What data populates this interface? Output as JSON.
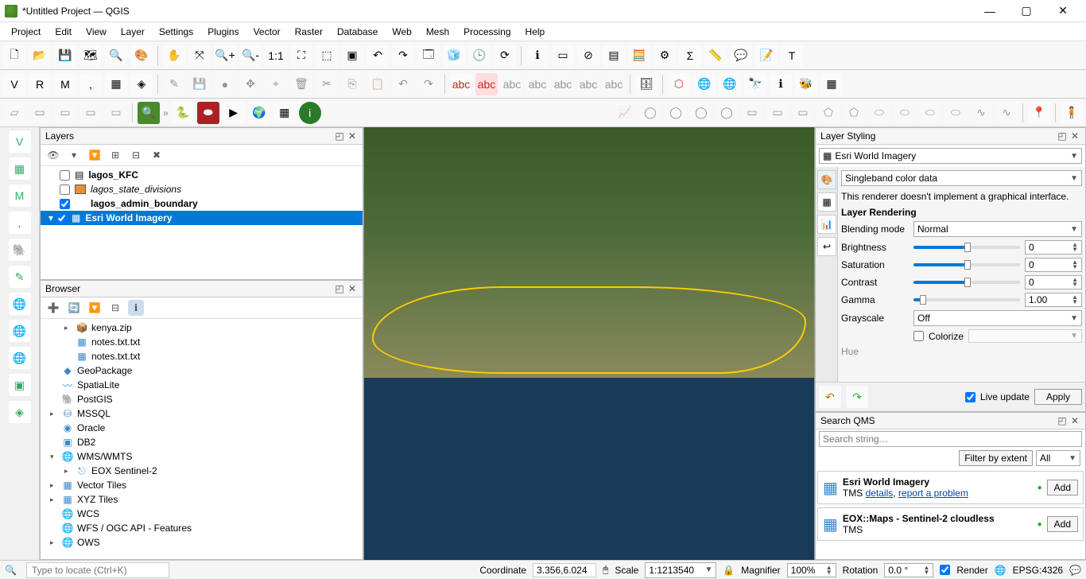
{
  "title": "*Untitled Project — QGIS",
  "menu": [
    "Project",
    "Edit",
    "View",
    "Layer",
    "Settings",
    "Plugins",
    "Vector",
    "Raster",
    "Database",
    "Web",
    "Mesh",
    "Processing",
    "Help"
  ],
  "layers_panel": {
    "title": "Layers",
    "items": [
      {
        "checked": false,
        "name": "lagos_KFC",
        "bold": true,
        "icon": "table"
      },
      {
        "checked": false,
        "name": "lagos_state_divisions",
        "italic": true,
        "swatch": "#e69138"
      },
      {
        "checked": true,
        "name": "lagos_admin_boundary",
        "bold": true
      },
      {
        "checked": true,
        "name": "Esri World Imagery",
        "bold": true,
        "selected": true,
        "raster": true
      }
    ]
  },
  "browser_panel": {
    "title": "Browser",
    "items": [
      {
        "indent": 1,
        "exp": "▸",
        "icon": "📦",
        "name": "kenya.zip"
      },
      {
        "indent": 1,
        "exp": "",
        "icon": "▦",
        "name": "notes.txt.txt"
      },
      {
        "indent": 1,
        "exp": "",
        "icon": "▦",
        "name": "notes.txt.txt"
      },
      {
        "indent": 0,
        "exp": "",
        "icon": "◆",
        "name": "GeoPackage"
      },
      {
        "indent": 0,
        "exp": "",
        "icon": "〰",
        "name": "SpatiaLite"
      },
      {
        "indent": 0,
        "exp": "",
        "icon": "🐘",
        "name": "PostGIS"
      },
      {
        "indent": 0,
        "exp": "▸",
        "icon": "⛁",
        "name": "MSSQL"
      },
      {
        "indent": 0,
        "exp": "",
        "icon": "◉",
        "name": "Oracle"
      },
      {
        "indent": 0,
        "exp": "",
        "icon": "▣",
        "name": "DB2"
      },
      {
        "indent": 0,
        "exp": "▾",
        "icon": "🌐",
        "name": "WMS/WMTS"
      },
      {
        "indent": 1,
        "exp": "▸",
        "icon": "⎋",
        "name": "EOX Sentinel-2"
      },
      {
        "indent": 0,
        "exp": "▸",
        "icon": "▦",
        "name": "Vector Tiles"
      },
      {
        "indent": 0,
        "exp": "▸",
        "icon": "▦",
        "name": "XYZ Tiles"
      },
      {
        "indent": 0,
        "exp": "",
        "icon": "🌐",
        "name": "WCS"
      },
      {
        "indent": 0,
        "exp": "",
        "icon": "🌐",
        "name": "WFS / OGC API - Features"
      },
      {
        "indent": 0,
        "exp": "▸",
        "icon": "🌐",
        "name": "OWS"
      }
    ]
  },
  "layer_styling": {
    "title": "Layer Styling",
    "layer": "Esri World Imagery",
    "renderer": "Singleband color data",
    "note": "This renderer doesn't implement a graphical interface.",
    "section": "Layer Rendering",
    "blending_label": "Blending mode",
    "blending": "Normal",
    "brightness_label": "Brightness",
    "brightness": "0",
    "saturation_label": "Saturation",
    "saturation": "0",
    "contrast_label": "Contrast",
    "contrast": "0",
    "gamma_label": "Gamma",
    "gamma": "1.00",
    "grayscale_label": "Grayscale",
    "grayscale": "Off",
    "colorize": "Colorize",
    "hue": "Hue",
    "live_update": "Live update",
    "apply": "Apply"
  },
  "qms": {
    "title": "Search QMS",
    "placeholder": "Search string…",
    "filter": "Filter by extent",
    "all": "All",
    "items": [
      {
        "name": "Esri World Imagery",
        "sub": "TMS",
        "details": "details",
        "report": "report a problem",
        "add": "Add"
      },
      {
        "name": "EOX::Maps - Sentinel-2 cloudless",
        "sub": "TMS",
        "details": "",
        "report": "",
        "add": "Add"
      }
    ]
  },
  "status": {
    "locator": "Type to locate (Ctrl+K)",
    "coord_label": "Coordinate",
    "coord": "3.356,6.024",
    "scale_label": "Scale",
    "scale": "1:1213540",
    "mag_label": "Magnifier",
    "mag": "100%",
    "rot_label": "Rotation",
    "rot": "0.0 °",
    "render": "Render",
    "crs": "EPSG:4326"
  }
}
